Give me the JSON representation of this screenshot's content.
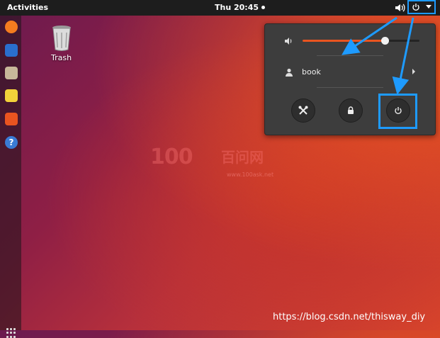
{
  "topbar": {
    "activities_label": "Activities",
    "clock": "Thu 20:45"
  },
  "tray": {
    "volume_icon": "speaker-icon",
    "power_icon": "power-icon",
    "menu_arrow_icon": "triangle-down-icon"
  },
  "dock": {
    "items": [
      {
        "name": "firefox-icon",
        "color": "#f57c1f"
      },
      {
        "name": "thunderbird-icon",
        "color": "#2a6fcf"
      },
      {
        "name": "files-icon",
        "color": "#c8b89a"
      },
      {
        "name": "rhythmbox-icon",
        "color": "#f3d23a"
      },
      {
        "name": "software-center-icon",
        "color": "#e95420"
      },
      {
        "name": "help-icon",
        "color": "#3a7bd5"
      }
    ]
  },
  "desktop": {
    "trash_label": "Trash"
  },
  "watermark": {
    "logo": "100",
    "cn": "百问网",
    "url": "www.100ask.net"
  },
  "menu": {
    "volume_level": 0.7,
    "user_name": "book",
    "buttons": [
      {
        "name": "settings-button",
        "icon": "settings-icon"
      },
      {
        "name": "lock-button",
        "icon": "lock-icon"
      },
      {
        "name": "power-off-button",
        "icon": "power-icon"
      }
    ]
  },
  "footer": {
    "csdn_url": "https://blog.csdn.net/thisway_diy"
  },
  "colors": {
    "accent": "#e95420",
    "highlight": "#1e9bff",
    "panel": "#1d1d1d",
    "menu_bg": "#3d3d3d"
  }
}
